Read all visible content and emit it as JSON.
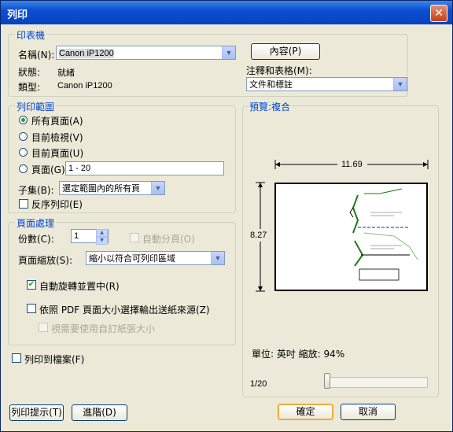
{
  "window": {
    "title": "列印",
    "close": "✕"
  },
  "printer": {
    "group_title": "印表機",
    "name_label": "名稱(N):",
    "name_value": "Canon iP1200",
    "status_label": "狀態:",
    "status_value": "就緒",
    "type_label": "類型:",
    "type_value": "Canon iP1200",
    "properties_button": "內容(P)",
    "comments_label": "注釋和表格(M):",
    "comments_value": "文件和標註"
  },
  "range": {
    "group_title": "列印範圍",
    "all_pages": "所有頁面(A)",
    "current_view": "目前檢視(V)",
    "current_page": "目前頁面(U)",
    "pages": "頁面(G)",
    "pages_value": "1 - 20",
    "subset_label": "子集(B):",
    "subset_value": "選定範圍內的所有頁",
    "reverse": "反序列印(E)"
  },
  "handling": {
    "group_title": "頁面處理",
    "copies_label": "份數(C):",
    "copies_value": "1",
    "collate": "自動分頁(O)",
    "scaling_label": "頁面縮放(S):",
    "scaling_value": "縮小以符合可列印區域",
    "auto_rotate": "自動旋轉並置中(R)",
    "pdf_size": "依照 PDF 頁面大小選擇輸出送紙來源(Z)",
    "custom_paper": "視需要使用自訂紙張大小"
  },
  "print_to_file": "列印到檔案(F)",
  "preview": {
    "group_title": "預覽:複合",
    "width": "11.69",
    "height": "8.27",
    "units_zoom": "單位: 英吋 縮放: 94%",
    "page_indicator": "1/20",
    "page_fraction": 0.05
  },
  "buttons": {
    "tips": "列印提示(T)",
    "advanced": "進階(D)",
    "ok": "確定",
    "cancel": "取消"
  },
  "colors": {
    "title_bar": "#0a4fd0",
    "group_title": "#0046d5",
    "radio_dot": "#21a121"
  }
}
